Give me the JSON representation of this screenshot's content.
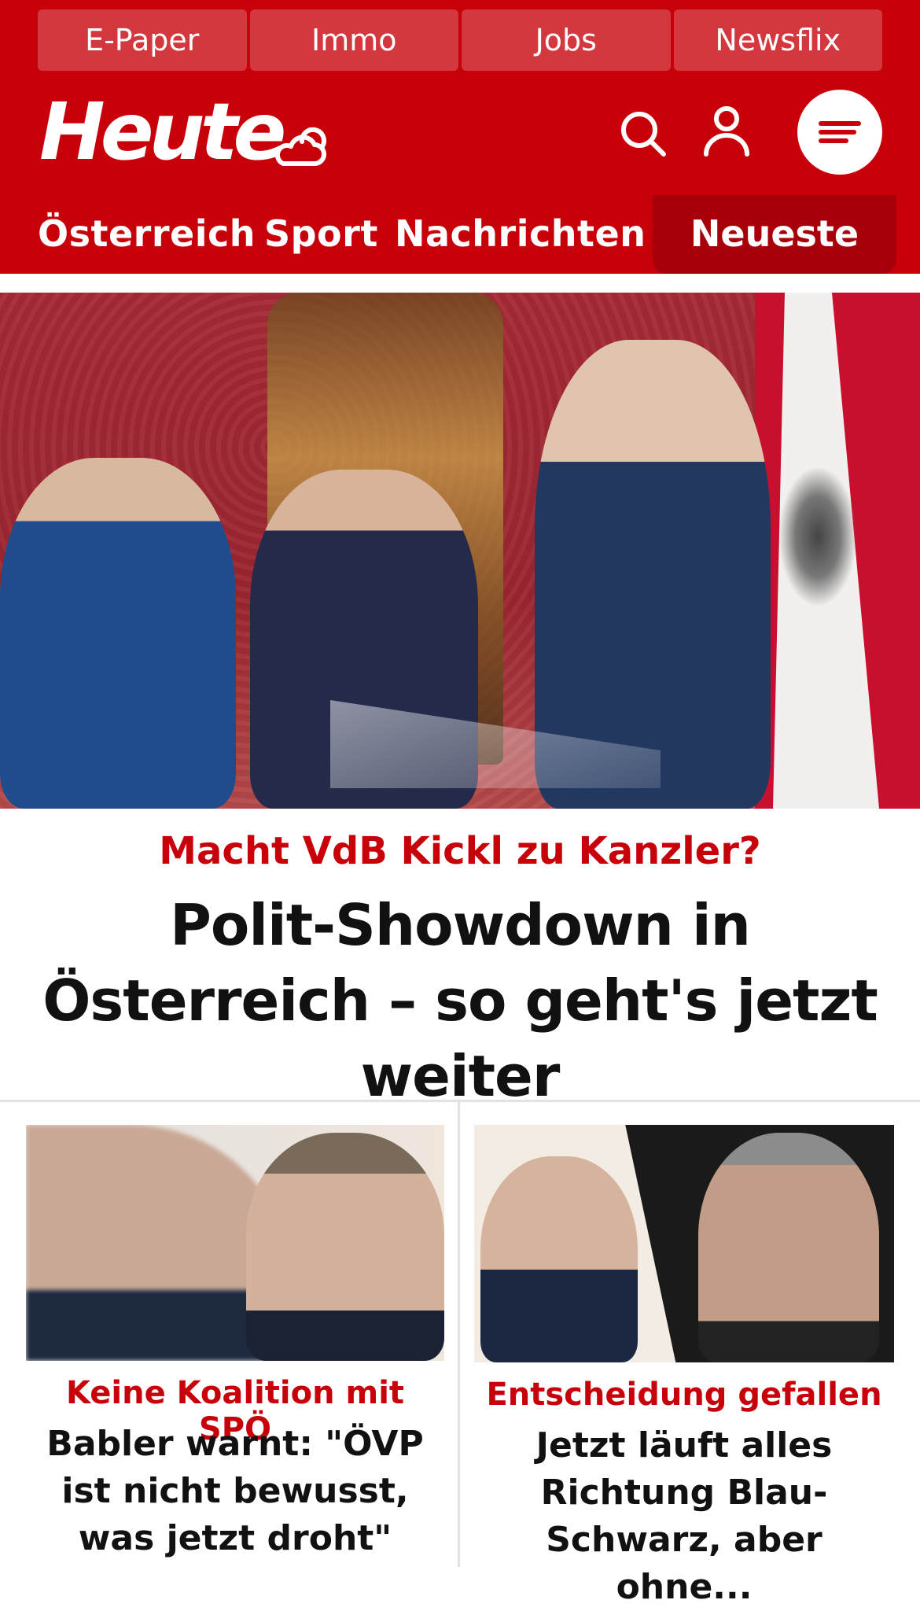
{
  "topbar": {
    "links": [
      "E-Paper",
      "Immo",
      "Jobs",
      "Newsflix"
    ]
  },
  "header": {
    "logo": "Heute",
    "icons": [
      "weather-icon",
      "search-icon",
      "user-icon",
      "menu-icon"
    ]
  },
  "nav": {
    "items": [
      "Österreich",
      "Sport",
      "Nachrichten"
    ],
    "active": "Neueste"
  },
  "hero": {
    "kicker": "Macht VdB Kickl zu Kanzler?",
    "headline": "Polit-Showdown in Österreich – so geht's jetzt weiter"
  },
  "cards": [
    {
      "kicker": "Keine Koalition mit SPÖ",
      "title": "Babler warnt: \"ÖVP ist nicht bewusst, was jetzt droht\""
    },
    {
      "kicker": "Entscheidung gefallen",
      "title": "Jetzt läuft alles Richtung Blau-Schwarz, aber ohne..."
    }
  ],
  "colors": {
    "brand": "#c8000a",
    "brand_dark": "#a8000a",
    "text": "#111111"
  }
}
